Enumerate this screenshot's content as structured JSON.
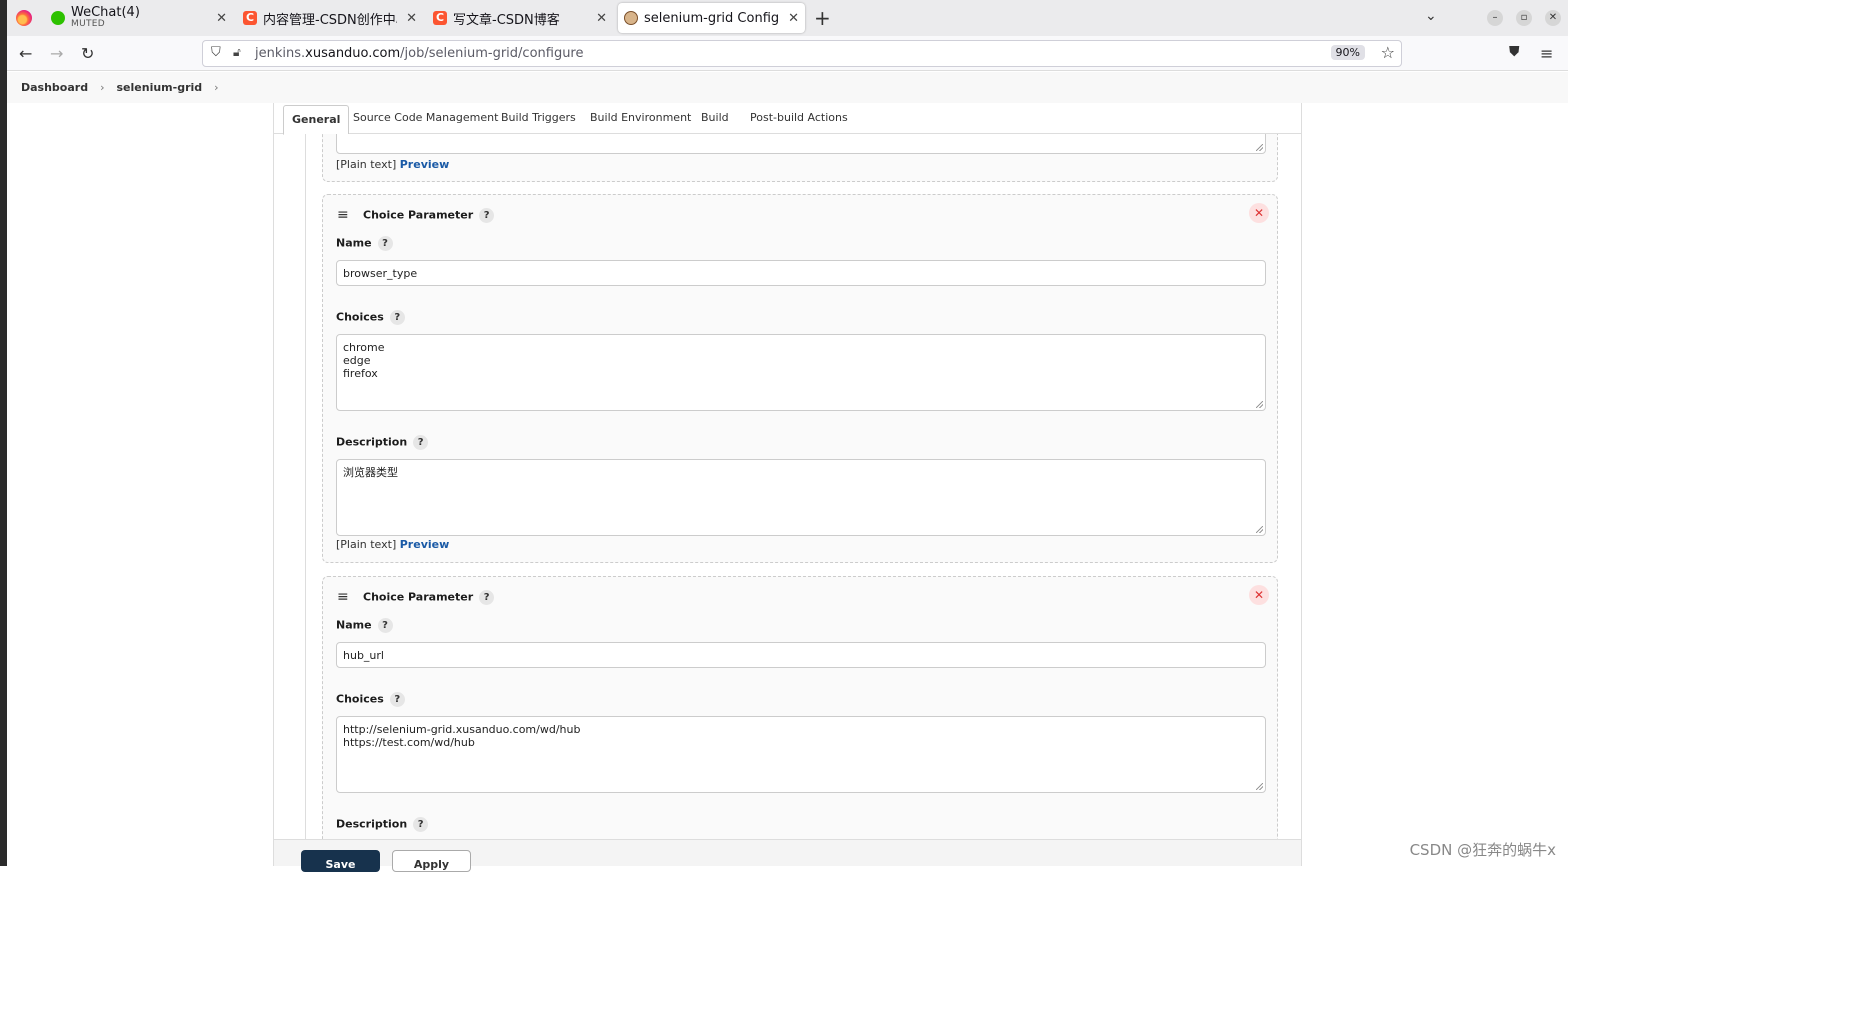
{
  "browser": {
    "tabs": [
      {
        "title": "WeChat(4)",
        "subtitle": "MUTED",
        "favicon": "wechat-icon"
      },
      {
        "title": "内容管理-CSDN创作中心",
        "favicon": "csdn-icon"
      },
      {
        "title": "写文章-CSDN博客",
        "favicon": "csdn-icon"
      },
      {
        "title": "selenium-grid Config [Jenkins]",
        "favicon": "jenkins-icon",
        "active": true
      }
    ],
    "url_prefix": "jenkins.",
    "url_domain": "xusanduo.com",
    "url_path": "/job/selenium-grid/configure",
    "zoom": "90%"
  },
  "breadcrumb": {
    "items": [
      "Dashboard",
      "selenium-grid"
    ]
  },
  "config_tabs": [
    "General",
    "Source Code Management",
    "Build Triggers",
    "Build Environment",
    "Build",
    "Post-build Actions"
  ],
  "prev_param": {
    "plain_text": "[Plain text]",
    "preview": "Preview"
  },
  "params": [
    {
      "type": "Choice Parameter",
      "name_label": "Name",
      "name_value": "browser_type",
      "choices_label": "Choices",
      "choices_value": "chrome\nedge\nfirefox",
      "description_label": "Description",
      "description_value": "浏览器类型",
      "plain_text": "[Plain text]",
      "preview": "Preview"
    },
    {
      "type": "Choice Parameter",
      "name_label": "Name",
      "name_value": "hub_url",
      "choices_label": "Choices",
      "choices_value": "http://selenium-grid.xusanduo.com/wd/hub\nhttps://test.com/wd/hub",
      "description_label": "Description"
    }
  ],
  "help_symbol": "?",
  "delete_symbol": "✕",
  "buttons": {
    "save": "Save",
    "apply": "Apply"
  },
  "watermark": "CSDN @狂奔的蜗牛x"
}
